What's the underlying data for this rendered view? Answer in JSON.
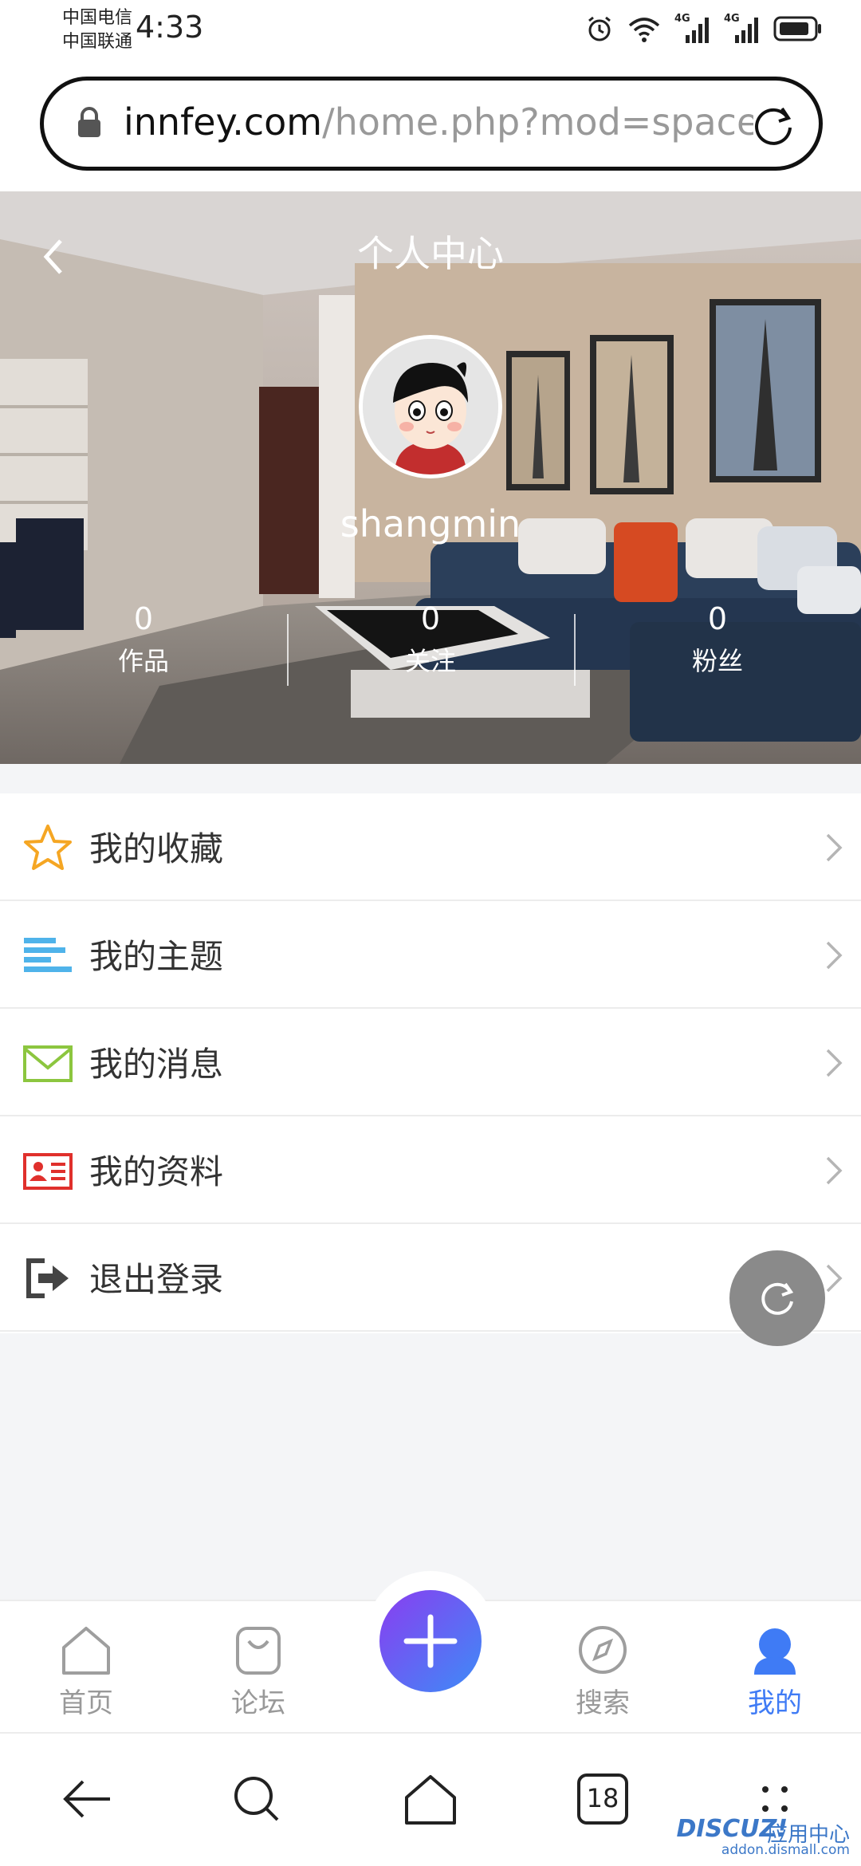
{
  "status_bar": {
    "carrier_1": "中国电信",
    "carrier_2": "中国联通",
    "time": "4:33",
    "network_1": "4G",
    "network_2": "4G"
  },
  "browser": {
    "url_host": "innfey.com",
    "url_path": "/home.php?mod=space"
  },
  "header": {
    "title": "个人中心",
    "username": "shangmin",
    "stats": [
      {
        "value": "0",
        "label": "作品"
      },
      {
        "value": "0",
        "label": "关注"
      },
      {
        "value": "0",
        "label": "粉丝"
      }
    ]
  },
  "menu": [
    {
      "label": "我的收藏",
      "icon": "star-icon",
      "color": "#f5a623"
    },
    {
      "label": "我的主题",
      "icon": "list-icon",
      "color": "#4fb3ea"
    },
    {
      "label": "我的消息",
      "icon": "mail-icon",
      "color": "#8cc63f"
    },
    {
      "label": "我的资料",
      "icon": "profile-card-icon",
      "color": "#e0302c"
    },
    {
      "label": "退出登录",
      "icon": "logout-icon",
      "color": "#444444"
    }
  ],
  "tab_bar": {
    "tabs": [
      {
        "label": "首页",
        "icon": "home-icon"
      },
      {
        "label": "论坛",
        "icon": "bag-icon"
      },
      {
        "label": "搜索",
        "icon": "compass-icon"
      },
      {
        "label": "我的",
        "icon": "user-icon"
      }
    ],
    "active_color": "#3f7bf5"
  },
  "system_nav": {
    "tabs_count": "18"
  },
  "watermark": {
    "logo": "DISCUZ!",
    "text": "应用中心",
    "url": "addon.dismall.com"
  }
}
